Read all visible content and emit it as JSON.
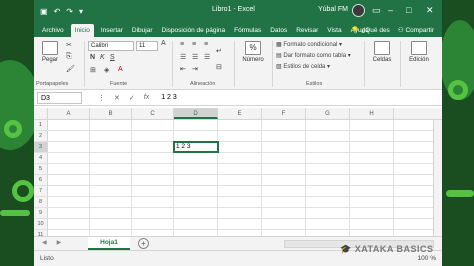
{
  "title_bar": {
    "title": "Libro1 - Excel",
    "user": "Yúbal FM"
  },
  "tabs": {
    "items": [
      "Archivo",
      "Inicio",
      "Insertar",
      "Dibujar",
      "Disposición de página",
      "Fórmulas",
      "Datos",
      "Revisar",
      "Vista",
      "Ayuda"
    ],
    "tell_me": "¿Qué des",
    "share": "Compartir"
  },
  "ribbon": {
    "paste_label": "Pegar",
    "clipboard_label": "Portapapeles",
    "font_name": "Calibri",
    "font_size": "11",
    "font_label": "Fuente",
    "alignment_label": "Alineación",
    "number_label": "Número",
    "conditional_format": "Formato condicional",
    "format_table": "Dar formato como tabla",
    "cell_styles": "Estilos de celda",
    "styles_label": "Estilos",
    "cells_label": "Celdas",
    "editing_label": "Edición"
  },
  "formula_bar": {
    "name_box": "D3",
    "value": "1 2 3",
    "cancel": "✕",
    "confirm": "✓",
    "fx": "fx"
  },
  "grid": {
    "columns": [
      "A",
      "B",
      "C",
      "D",
      "E",
      "F",
      "G",
      "H"
    ],
    "rows": [
      "1",
      "2",
      "3",
      "4",
      "5",
      "6",
      "7",
      "8",
      "9",
      "10",
      "11",
      "12"
    ],
    "active_cell_value": "1 2 3"
  },
  "sheets": {
    "tabs": [
      "Hoja1"
    ]
  },
  "status": {
    "mode": "Listo",
    "zoom": "100 %"
  },
  "watermark": "XATAKA BASICS",
  "colors": {
    "accent": "#217346",
    "background": "#1a4d1f"
  }
}
